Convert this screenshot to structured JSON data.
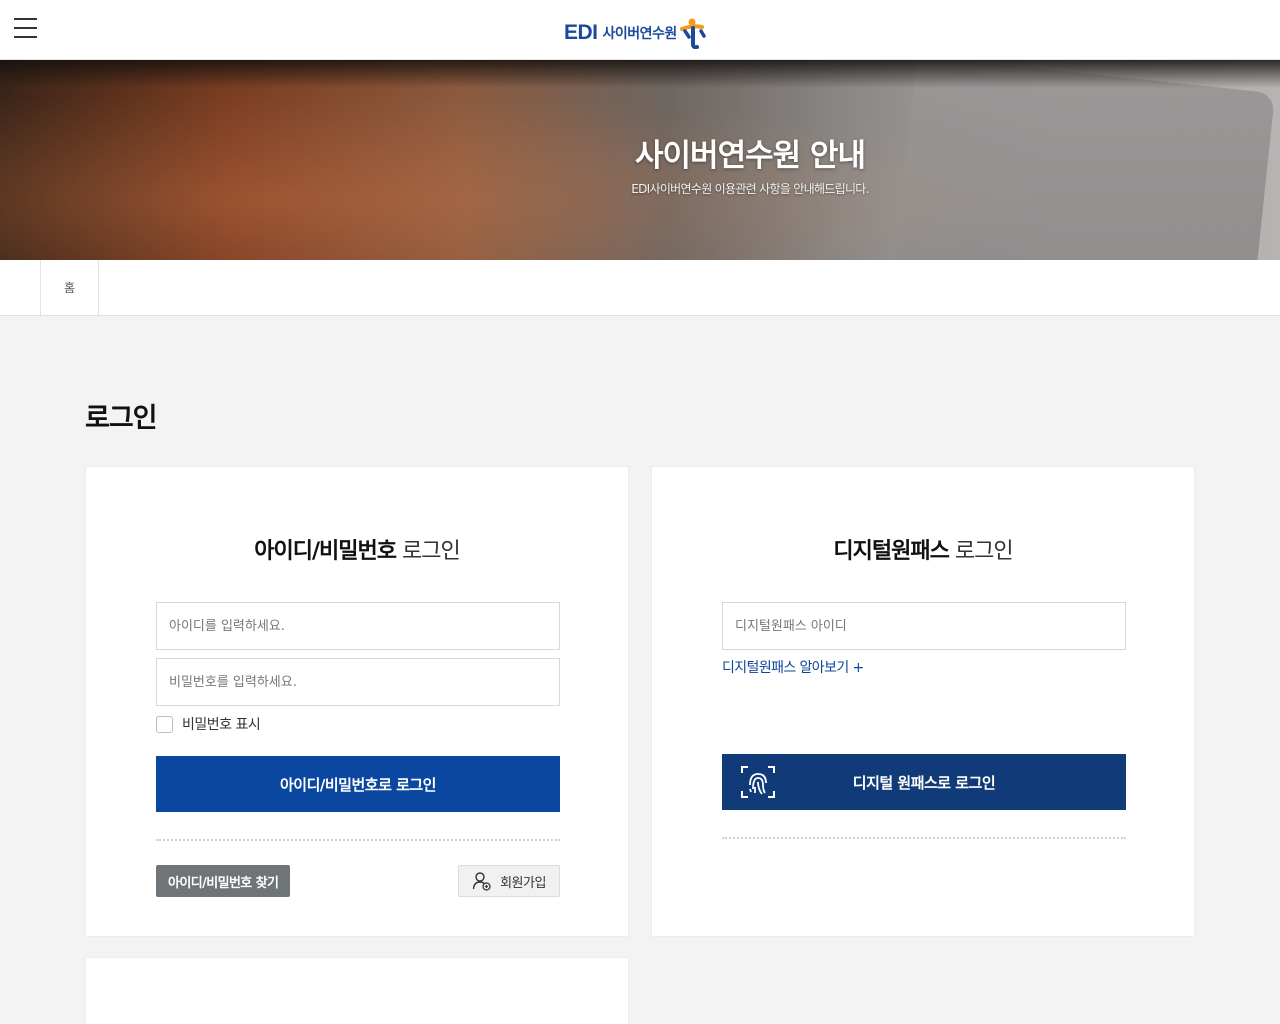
{
  "header": {
    "menu_icon": "hamburger-icon",
    "logo_prefix": "EDI",
    "logo_text": "사이버연수원",
    "logo_mark_colors": [
      "#f39a1e",
      "#1a4a9c"
    ]
  },
  "banner": {
    "title": "사이버연수원 안내",
    "subtitle": "EDI사이버연수원 이용관련 사항을 안내해드립니다."
  },
  "breadcrumb": {
    "home": "홈"
  },
  "page": {
    "title": "로그인"
  },
  "id_login": {
    "title_bold": "아이디/비밀번호",
    "title_light": " 로그인",
    "id_placeholder": "아이디를 입력하세요.",
    "pw_placeholder": "비밀번호를 입력하세요.",
    "show_pw_label": "비밀번호 표시",
    "login_button": "아이디/비밀번호로 로그인",
    "find_button": "아이디/비밀번호 찾기",
    "join_button": "회원가입",
    "join_icon": "user-add-icon"
  },
  "dp_login": {
    "title_bold": "디지털원패스",
    "title_light": " 로그인",
    "id_placeholder": "디지털원패스 아이디",
    "learn_more": "디지털원패스 알아보기 +",
    "login_button": "디지털 원패스로 로그인",
    "button_icon": "fingerprint-icon"
  },
  "colors": {
    "primary": "#0a47a0",
    "onepass": "#113a78",
    "brand": "#1a4a9c"
  }
}
